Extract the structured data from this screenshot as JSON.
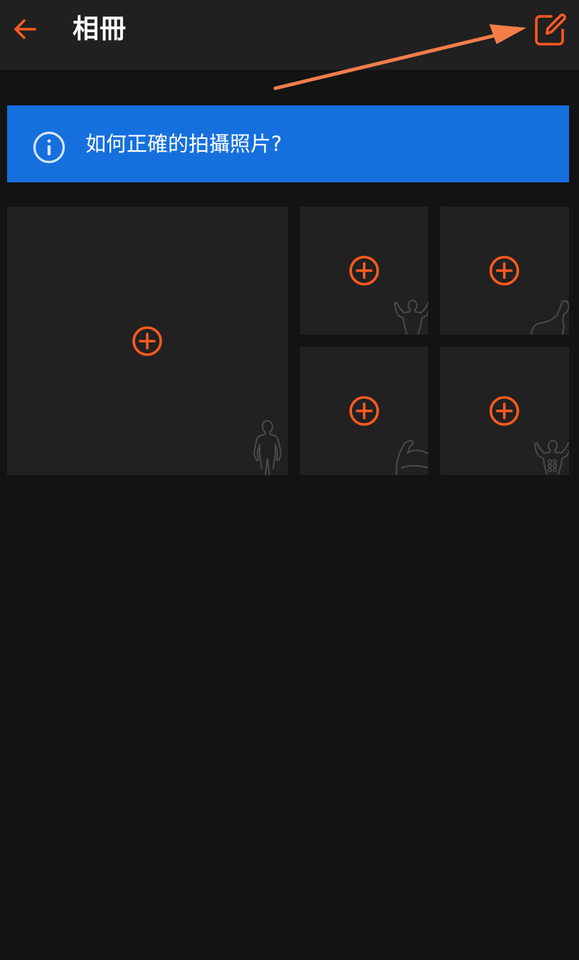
{
  "header": {
    "title": "相冊",
    "back_icon": "arrow-left-icon",
    "edit_icon": "edit-square-icon",
    "accent_color": "#ff5a1f"
  },
  "info_banner": {
    "text": "如何正確的拍攝照片?",
    "icon": "info-circle-icon",
    "background": "#1570de"
  },
  "photo_slots": [
    {
      "pose": "front-full-body",
      "icon": "plus-circle-icon"
    },
    {
      "pose": "front-double-biceps",
      "icon": "plus-circle-icon"
    },
    {
      "pose": "side-biceps",
      "icon": "plus-circle-icon"
    },
    {
      "pose": "arm-flex",
      "icon": "plus-circle-icon"
    },
    {
      "pose": "abs-and-thigh",
      "icon": "plus-circle-icon"
    }
  ]
}
